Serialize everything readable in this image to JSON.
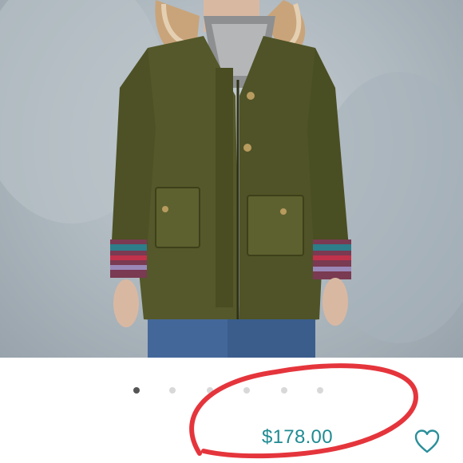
{
  "product_photo": {
    "icon": "parka-jacket-image"
  },
  "carousel": {
    "page_count": 6,
    "active_index": 0
  },
  "listing": {
    "price": "$178.00"
  },
  "actions": {
    "like_icon": "heart-outline-icon"
  },
  "annotation": {
    "circle_color": "#e5353c"
  },
  "colors": {
    "price": "#1f8b92",
    "heart": "#2a8f9a"
  }
}
